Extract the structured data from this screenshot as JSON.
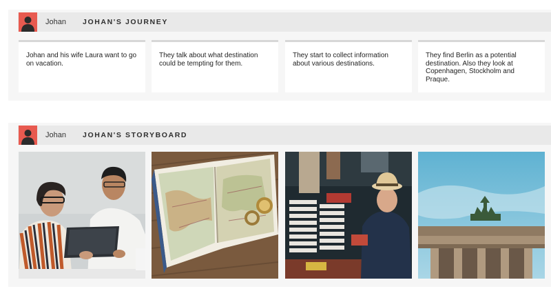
{
  "journey": {
    "user_name": "Johan",
    "title": "JOHAN'S JOURNEY",
    "steps": [
      {
        "text": "Johan and his wife Laura want to go on vacation."
      },
      {
        "text": "They talk about what destination could be tempting for them."
      },
      {
        "text": "They start to collect information about various destinations."
      },
      {
        "text": "They find Berlin as a potential destination. Also they look at Copenhagen, Stockholm and Praque."
      }
    ]
  },
  "storyboard": {
    "user_name": "Johan",
    "title": "JOHAN'S STORYBOARD"
  },
  "colors": {
    "avatar_bg": "#e85a50",
    "header_bg": "#e9e9e9",
    "section_bg": "#f6f6f6"
  },
  "icons": {
    "avatar": "user-silhouette-icon"
  }
}
